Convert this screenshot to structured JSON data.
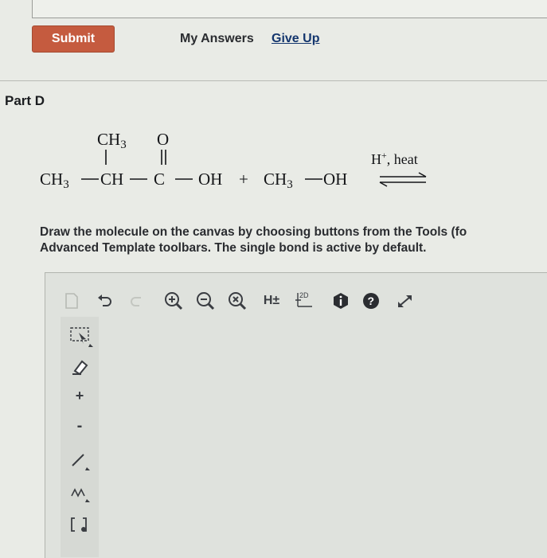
{
  "header": {
    "submit_label": "Submit",
    "my_answers_label": "My Answers",
    "give_up_label": "Give Up"
  },
  "part": {
    "title": "Part D"
  },
  "reaction": {
    "reactant1_branch": "CH3",
    "reactant1_carbonyl_o": "O",
    "reactant1_chain": [
      "CH3",
      "CH",
      "C",
      "OH"
    ],
    "plus": "+",
    "reactant2": [
      "CH3",
      "OH"
    ],
    "conditions": "H+, heat"
  },
  "instructions": {
    "line1": "Draw the molecule on the canvas by choosing buttons from the Tools (fo",
    "line2": "Advanced Template toolbars. The single bond is active by default."
  },
  "toolbar": {
    "icons": [
      "new-document",
      "undo",
      "redo",
      "zoom-in",
      "zoom-out",
      "zoom-reset",
      "explicit-hydrogens",
      "2d-clean",
      "info",
      "help",
      "fullscreen"
    ],
    "hydrogen_label": "H±",
    "clean_label": "2D"
  },
  "colors": {
    "submit_bg": "#c55b3f",
    "link": "#14366e",
    "canvas": "#dfe2dd",
    "toolbar_icon": "#3a3d42"
  }
}
